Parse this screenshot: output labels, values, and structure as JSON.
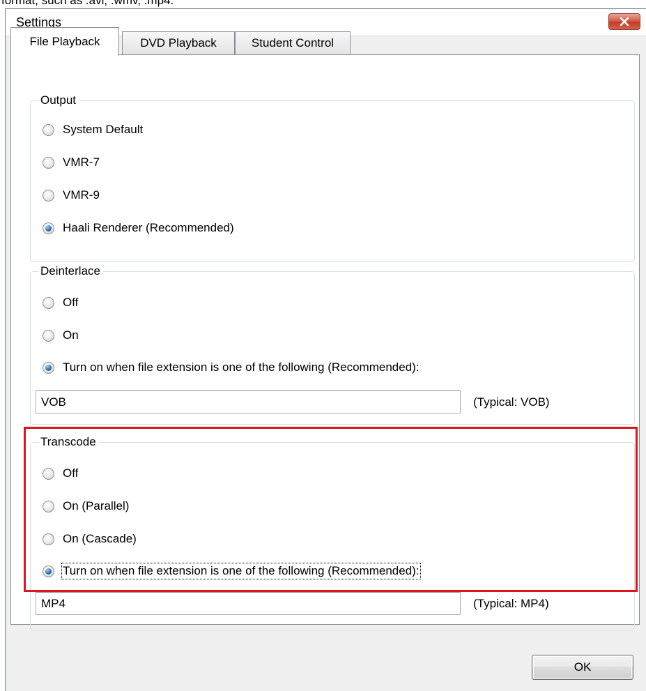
{
  "background_text": "format, such as .avi, .wmv, .mp4.",
  "window": {
    "title": "Settings",
    "close_icon": "close-x-icon"
  },
  "tabs": [
    {
      "label": "File Playback",
      "active": true
    },
    {
      "label": "DVD Playback",
      "active": false
    },
    {
      "label": "Student Control",
      "active": false
    }
  ],
  "output": {
    "legend": "Output",
    "options": [
      {
        "label": "System Default",
        "checked": false
      },
      {
        "label": "VMR-7",
        "checked": false
      },
      {
        "label": "VMR-9",
        "checked": false
      },
      {
        "label": "Haali Renderer (Recommended)",
        "checked": true
      }
    ]
  },
  "deinterlace": {
    "legend": "Deinterlace",
    "options": [
      {
        "label": "Off",
        "checked": false
      },
      {
        "label": "On",
        "checked": false
      },
      {
        "label": "Turn on when file extension is one of the following (Recommended):",
        "checked": true
      }
    ],
    "extension_value": "VOB",
    "typical": "(Typical: VOB)"
  },
  "transcode": {
    "legend": "Transcode",
    "options": [
      {
        "label": "Off",
        "checked": false
      },
      {
        "label": "On (Parallel)",
        "checked": false
      },
      {
        "label": "On (Cascade)",
        "checked": false
      },
      {
        "label": "Turn on when file extension is one of the following (Recommended):",
        "checked": true
      }
    ],
    "extension_value": "MP4",
    "typical": "(Typical: MP4)",
    "highlight_color": "#e0141b"
  },
  "buttons": {
    "ok_label": "OK"
  }
}
